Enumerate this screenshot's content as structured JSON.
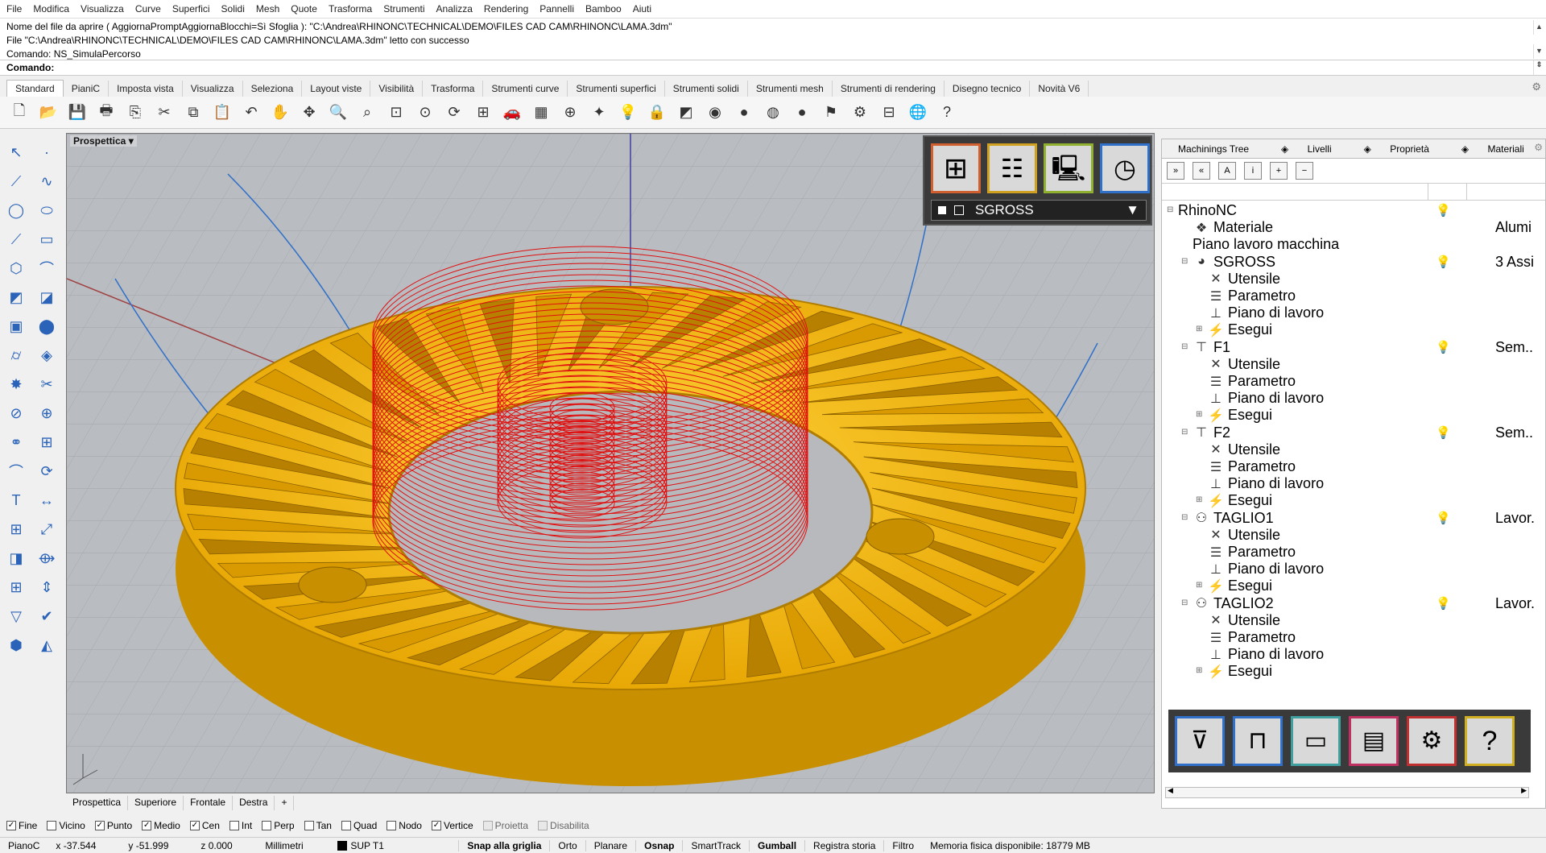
{
  "menu": [
    "File",
    "Modifica",
    "Visualizza",
    "Curve",
    "Superfici",
    "Solidi",
    "Mesh",
    "Quote",
    "Trasforma",
    "Strumenti",
    "Analizza",
    "Rendering",
    "Pannelli",
    "Bamboo",
    "Aiuti"
  ],
  "command_history": [
    "Nome del file da aprire ( AggiornaPromptAggiornaBlocchi=Sì  Sfoglia ): \"C:\\Andrea\\RHINONC\\TECHNICAL\\DEMO\\FILES CAD CAM\\RHINONC\\LAMA.3dm\"",
    "File \"C:\\Andrea\\RHINONC\\TECHNICAL\\DEMO\\FILES CAD CAM\\RHINONC\\LAMA.3dm\" letto con successo",
    "Comando: NS_SimulaPercorso"
  ],
  "command_prompt": "Comando:",
  "toolbar_tabs": [
    "Standard",
    "PianiC",
    "Imposta vista",
    "Visualizza",
    "Seleziona",
    "Layout viste",
    "Visibilità",
    "Trasforma",
    "Strumenti curve",
    "Strumenti superfici",
    "Strumenti solidi",
    "Strumenti mesh",
    "Strumenti di rendering",
    "Disegno tecnico",
    "Novità V6"
  ],
  "toolbar_icons": [
    "new-icon",
    "open-icon",
    "save-icon",
    "print-icon",
    "import-icon",
    "cut-icon",
    "copy-icon",
    "paste-icon",
    "undo-icon",
    "pan-icon",
    "rotate-icon",
    "zoom-icon",
    "zoom-window-icon",
    "zoom-extents-icon",
    "zoom-selected-icon",
    "rotate-view-icon",
    "four-views-icon",
    "car-icon",
    "grid-icon",
    "osnap-icon",
    "gumball-icon",
    "light-icon",
    "lock-icon",
    "layer-icon",
    "color-wheel-icon",
    "shade-icon",
    "render-icon",
    "sphere-icon",
    "flag-icon",
    "gear-icon",
    "properties-icon",
    "globe-icon",
    "help-icon"
  ],
  "toolbar_glyphs": [
    "🗋",
    "📂",
    "💾",
    "🖶",
    "⎘",
    "✂",
    "⧉",
    "📋",
    "↶",
    "✋",
    "✥",
    "🔍",
    "⌕",
    "⊡",
    "⊙",
    "⟳",
    "⊞",
    "🚗",
    "▦",
    "⊕",
    "✦",
    "💡",
    "🔒",
    "◩",
    "◉",
    "●",
    "◍",
    "●",
    "⚑",
    "⚙",
    "⊟",
    "🌐",
    "?"
  ],
  "viewport": {
    "label": "Prospettica",
    "tabs": [
      "Prospettica",
      "Superiore",
      "Frontale",
      "Destra"
    ]
  },
  "machining_combo": "SGROSS",
  "right_panel": {
    "tabs": [
      "Machinings Tree",
      "Livelli",
      "Proprietà",
      "Materiali"
    ],
    "tree": [
      {
        "label": "RhinoNC",
        "indent": 0,
        "icon": "rhino-icon",
        "glyph": "",
        "bulb": "on",
        "value": ""
      },
      {
        "label": "Materiale",
        "indent": 1,
        "icon": "material-icon",
        "glyph": "❖",
        "bulb": "",
        "value": "Alumi"
      },
      {
        "label": "Piano lavoro macchina",
        "indent": 1,
        "icon": "plane-icon",
        "glyph": "",
        "bulb": "",
        "value": ""
      },
      {
        "label": "SGROSS",
        "indent": 1,
        "icon": "operation-icon",
        "glyph": "◕",
        "bulb": "on",
        "value": "3 Assi"
      },
      {
        "label": "Utensile",
        "indent": 2,
        "icon": "tool-icon",
        "glyph": "✕",
        "bulb": "",
        "value": ""
      },
      {
        "label": "Parametro",
        "indent": 2,
        "icon": "parameter-icon",
        "glyph": "☰",
        "bulb": "",
        "value": ""
      },
      {
        "label": "Piano di lavoro",
        "indent": 2,
        "icon": "work-plane-icon",
        "glyph": "⊥",
        "bulb": "",
        "value": ""
      },
      {
        "label": "Esegui",
        "indent": 2,
        "icon": "execute-icon",
        "glyph": "⚡",
        "bulb": "",
        "value": ""
      },
      {
        "label": "F1",
        "indent": 1,
        "icon": "drill-icon",
        "glyph": "⊤",
        "bulb": "off",
        "value": "Sem.."
      },
      {
        "label": "Utensile",
        "indent": 2,
        "icon": "tool-icon",
        "glyph": "✕",
        "bulb": "",
        "value": ""
      },
      {
        "label": "Parametro",
        "indent": 2,
        "icon": "parameter-icon",
        "glyph": "☰",
        "bulb": "",
        "value": ""
      },
      {
        "label": "Piano di lavoro",
        "indent": 2,
        "icon": "work-plane-icon",
        "glyph": "⊥",
        "bulb": "",
        "value": ""
      },
      {
        "label": "Esegui",
        "indent": 2,
        "icon": "execute-icon",
        "glyph": "⚡",
        "bulb": "",
        "value": ""
      },
      {
        "label": "F2",
        "indent": 1,
        "icon": "drill-icon",
        "glyph": "⊤",
        "bulb": "on",
        "value": "Sem.."
      },
      {
        "label": "Utensile",
        "indent": 2,
        "icon": "tool-icon",
        "glyph": "✕",
        "bulb": "",
        "value": ""
      },
      {
        "label": "Parametro",
        "indent": 2,
        "icon": "parameter-icon",
        "glyph": "☰",
        "bulb": "",
        "value": ""
      },
      {
        "label": "Piano di lavoro",
        "indent": 2,
        "icon": "work-plane-icon",
        "glyph": "⊥",
        "bulb": "",
        "value": ""
      },
      {
        "label": "Esegui",
        "indent": 2,
        "icon": "execute-icon",
        "glyph": "⚡",
        "bulb": "",
        "value": ""
      },
      {
        "label": "TAGLIO1",
        "indent": 1,
        "icon": "cut-operation-icon",
        "glyph": "⚇",
        "bulb": "on",
        "value": "Lavor."
      },
      {
        "label": "Utensile",
        "indent": 2,
        "icon": "tool-icon",
        "glyph": "✕",
        "bulb": "",
        "value": ""
      },
      {
        "label": "Parametro",
        "indent": 2,
        "icon": "parameter-icon",
        "glyph": "☰",
        "bulb": "",
        "value": ""
      },
      {
        "label": "Piano di lavoro",
        "indent": 2,
        "icon": "work-plane-icon",
        "glyph": "⊥",
        "bulb": "",
        "value": ""
      },
      {
        "label": "Esegui",
        "indent": 2,
        "icon": "execute-icon",
        "glyph": "⚡",
        "bulb": "",
        "value": ""
      },
      {
        "label": "TAGLIO2",
        "indent": 1,
        "icon": "cut-operation-icon",
        "glyph": "⚇",
        "bulb": "off",
        "value": "Lavor."
      },
      {
        "label": "Utensile",
        "indent": 2,
        "icon": "tool-icon",
        "glyph": "✕",
        "bulb": "",
        "value": ""
      },
      {
        "label": "Parametro",
        "indent": 2,
        "icon": "parameter-icon",
        "glyph": "☰",
        "bulb": "",
        "value": ""
      },
      {
        "label": "Piano di lavoro",
        "indent": 2,
        "icon": "work-plane-icon",
        "glyph": "⊥",
        "bulb": "",
        "value": ""
      },
      {
        "label": "Esegui",
        "indent": 2,
        "icon": "execute-icon",
        "glyph": "⚡",
        "bulb": "",
        "value": ""
      }
    ]
  },
  "osnaps": [
    {
      "label": "Fine",
      "checked": true,
      "disabled": false
    },
    {
      "label": "Vicino",
      "checked": false,
      "disabled": false
    },
    {
      "label": "Punto",
      "checked": true,
      "disabled": false
    },
    {
      "label": "Medio",
      "checked": true,
      "disabled": false
    },
    {
      "label": "Cen",
      "checked": true,
      "disabled": false
    },
    {
      "label": "Int",
      "checked": false,
      "disabled": false
    },
    {
      "label": "Perp",
      "checked": false,
      "disabled": false
    },
    {
      "label": "Tan",
      "checked": false,
      "disabled": false
    },
    {
      "label": "Quad",
      "checked": false,
      "disabled": false
    },
    {
      "label": "Nodo",
      "checked": false,
      "disabled": false
    },
    {
      "label": "Vertice",
      "checked": true,
      "disabled": false
    },
    {
      "label": "Proietta",
      "checked": false,
      "disabled": true
    },
    {
      "label": "Disabilita",
      "checked": false,
      "disabled": true
    }
  ],
  "status": {
    "plane": "PianoC",
    "x": "x -37.544",
    "y": "y -51.999",
    "z": "z 0.000",
    "units": "Millimetri",
    "layer": "SUP T1",
    "toggles": [
      {
        "label": "Snap alla griglia",
        "bold": true
      },
      {
        "label": "Orto",
        "bold": false
      },
      {
        "label": "Planare",
        "bold": false
      },
      {
        "label": "Osnap",
        "bold": true
      },
      {
        "label": "SmartTrack",
        "bold": false
      },
      {
        "label": "Gumball",
        "bold": true
      },
      {
        "label": "Registra storia",
        "bold": false
      },
      {
        "label": "Filtro",
        "bold": false
      }
    ],
    "memory": "Memoria fisica disponibile: 18779 MB"
  },
  "colors": {
    "part": "#f5b800",
    "part_dark": "#c78f00",
    "toolpath": "#e01010",
    "viewport_bg": "#b9bcc1"
  }
}
